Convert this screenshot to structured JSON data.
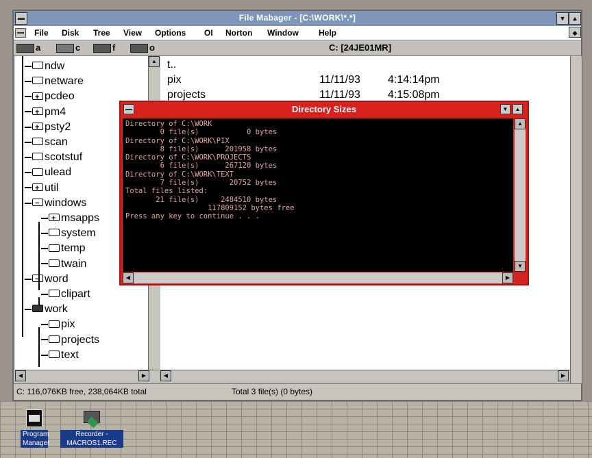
{
  "app": {
    "title": "File Mabager - [C:\\WORK\\*.*]"
  },
  "menu": [
    "File",
    "Disk",
    "Tree",
    "View",
    "Options",
    "OI",
    "Norton",
    "Window",
    "Help"
  ],
  "drives": [
    {
      "letter": "a",
      "selected": false
    },
    {
      "letter": "c",
      "selected": true
    },
    {
      "letter": "f",
      "selected": false
    },
    {
      "letter": "o",
      "selected": false
    }
  ],
  "path_label": "C: [24JE01MR]",
  "tree": [
    {
      "name": "ndw",
      "state": "closed"
    },
    {
      "name": "netware",
      "state": "closed"
    },
    {
      "name": "pcdeo",
      "state": "plus"
    },
    {
      "name": "pm4",
      "state": "plus"
    },
    {
      "name": "psty2",
      "state": "plus"
    },
    {
      "name": "scan",
      "state": "closed"
    },
    {
      "name": "scotstuf",
      "state": "closed"
    },
    {
      "name": "ulead",
      "state": "closed"
    },
    {
      "name": "util",
      "state": "plus"
    },
    {
      "name": "windows",
      "state": "minus"
    },
    {
      "name": "msapps",
      "state": "plus"
    },
    {
      "name": "system",
      "state": "closed"
    },
    {
      "name": "temp",
      "state": "closed"
    },
    {
      "name": "twain",
      "state": "closed"
    },
    {
      "name": "word",
      "state": "minus"
    },
    {
      "name": "clipart",
      "state": "closed"
    },
    {
      "name": "work",
      "state": "open"
    },
    {
      "name": "pix",
      "state": "closed"
    },
    {
      "name": "projects",
      "state": "closed"
    },
    {
      "name": "text",
      "state": "closed"
    }
  ],
  "files": [
    {
      "name": "t..",
      "date": "",
      "time": ""
    },
    {
      "name": "pix",
      "date": "11/11/93",
      "time": "4:14:14pm"
    },
    {
      "name": "projects",
      "date": "11/11/93",
      "time": "4:15:08pm"
    }
  ],
  "status": {
    "disk": "C: 116,076KB free, 238,064KB total",
    "files": "Total 3 file(s) (0 bytes)"
  },
  "dialog": {
    "title": "Directory Sizes",
    "console_lines": [
      "Directory of C:\\WORK",
      "        0 file(s)           0 bytes",
      "Directory of C:\\WORK\\PIX",
      "        8 file(s)      201958 bytes",
      "Directory of C:\\WORK\\PROJECTS",
      "        6 file(s)      267120 bytes",
      "Directory of C:\\WORK\\TEXT",
      "        7 file(s)       20752 bytes",
      "Total files listed:",
      "       21 file(s)     2484510 bytes",
      "                   117809152 bytes free",
      "Press any key to continue . . ."
    ]
  },
  "desktop_icons": [
    {
      "label_line1": "Program",
      "label_line2": "Manager"
    },
    {
      "label_line1": "Recorder -",
      "label_line2": "MACROS1.REC"
    }
  ]
}
